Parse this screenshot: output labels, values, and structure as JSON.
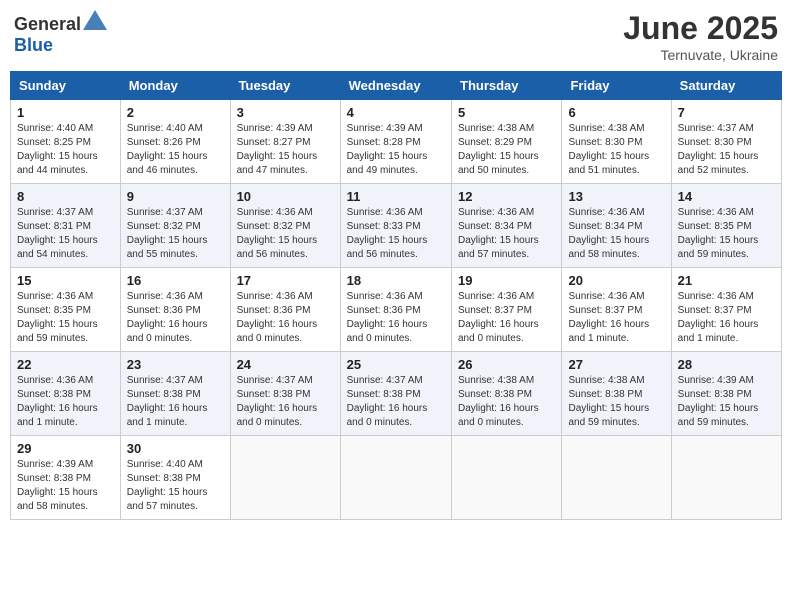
{
  "header": {
    "logo_general": "General",
    "logo_blue": "Blue",
    "month_title": "June 2025",
    "subtitle": "Ternuvate, Ukraine"
  },
  "days_of_week": [
    "Sunday",
    "Monday",
    "Tuesday",
    "Wednesday",
    "Thursday",
    "Friday",
    "Saturday"
  ],
  "weeks": [
    [
      {
        "day": "1",
        "info": "Sunrise: 4:40 AM\nSunset: 8:25 PM\nDaylight: 15 hours\nand 44 minutes."
      },
      {
        "day": "2",
        "info": "Sunrise: 4:40 AM\nSunset: 8:26 PM\nDaylight: 15 hours\nand 46 minutes."
      },
      {
        "day": "3",
        "info": "Sunrise: 4:39 AM\nSunset: 8:27 PM\nDaylight: 15 hours\nand 47 minutes."
      },
      {
        "day": "4",
        "info": "Sunrise: 4:39 AM\nSunset: 8:28 PM\nDaylight: 15 hours\nand 49 minutes."
      },
      {
        "day": "5",
        "info": "Sunrise: 4:38 AM\nSunset: 8:29 PM\nDaylight: 15 hours\nand 50 minutes."
      },
      {
        "day": "6",
        "info": "Sunrise: 4:38 AM\nSunset: 8:30 PM\nDaylight: 15 hours\nand 51 minutes."
      },
      {
        "day": "7",
        "info": "Sunrise: 4:37 AM\nSunset: 8:30 PM\nDaylight: 15 hours\nand 52 minutes."
      }
    ],
    [
      {
        "day": "8",
        "info": "Sunrise: 4:37 AM\nSunset: 8:31 PM\nDaylight: 15 hours\nand 54 minutes."
      },
      {
        "day": "9",
        "info": "Sunrise: 4:37 AM\nSunset: 8:32 PM\nDaylight: 15 hours\nand 55 minutes."
      },
      {
        "day": "10",
        "info": "Sunrise: 4:36 AM\nSunset: 8:32 PM\nDaylight: 15 hours\nand 56 minutes."
      },
      {
        "day": "11",
        "info": "Sunrise: 4:36 AM\nSunset: 8:33 PM\nDaylight: 15 hours\nand 56 minutes."
      },
      {
        "day": "12",
        "info": "Sunrise: 4:36 AM\nSunset: 8:34 PM\nDaylight: 15 hours\nand 57 minutes."
      },
      {
        "day": "13",
        "info": "Sunrise: 4:36 AM\nSunset: 8:34 PM\nDaylight: 15 hours\nand 58 minutes."
      },
      {
        "day": "14",
        "info": "Sunrise: 4:36 AM\nSunset: 8:35 PM\nDaylight: 15 hours\nand 59 minutes."
      }
    ],
    [
      {
        "day": "15",
        "info": "Sunrise: 4:36 AM\nSunset: 8:35 PM\nDaylight: 15 hours\nand 59 minutes."
      },
      {
        "day": "16",
        "info": "Sunrise: 4:36 AM\nSunset: 8:36 PM\nDaylight: 16 hours\nand 0 minutes."
      },
      {
        "day": "17",
        "info": "Sunrise: 4:36 AM\nSunset: 8:36 PM\nDaylight: 16 hours\nand 0 minutes."
      },
      {
        "day": "18",
        "info": "Sunrise: 4:36 AM\nSunset: 8:36 PM\nDaylight: 16 hours\nand 0 minutes."
      },
      {
        "day": "19",
        "info": "Sunrise: 4:36 AM\nSunset: 8:37 PM\nDaylight: 16 hours\nand 0 minutes."
      },
      {
        "day": "20",
        "info": "Sunrise: 4:36 AM\nSunset: 8:37 PM\nDaylight: 16 hours\nand 1 minute."
      },
      {
        "day": "21",
        "info": "Sunrise: 4:36 AM\nSunset: 8:37 PM\nDaylight: 16 hours\nand 1 minute."
      }
    ],
    [
      {
        "day": "22",
        "info": "Sunrise: 4:36 AM\nSunset: 8:38 PM\nDaylight: 16 hours\nand 1 minute."
      },
      {
        "day": "23",
        "info": "Sunrise: 4:37 AM\nSunset: 8:38 PM\nDaylight: 16 hours\nand 1 minute."
      },
      {
        "day": "24",
        "info": "Sunrise: 4:37 AM\nSunset: 8:38 PM\nDaylight: 16 hours\nand 0 minutes."
      },
      {
        "day": "25",
        "info": "Sunrise: 4:37 AM\nSunset: 8:38 PM\nDaylight: 16 hours\nand 0 minutes."
      },
      {
        "day": "26",
        "info": "Sunrise: 4:38 AM\nSunset: 8:38 PM\nDaylight: 16 hours\nand 0 minutes."
      },
      {
        "day": "27",
        "info": "Sunrise: 4:38 AM\nSunset: 8:38 PM\nDaylight: 15 hours\nand 59 minutes."
      },
      {
        "day": "28",
        "info": "Sunrise: 4:39 AM\nSunset: 8:38 PM\nDaylight: 15 hours\nand 59 minutes."
      }
    ],
    [
      {
        "day": "29",
        "info": "Sunrise: 4:39 AM\nSunset: 8:38 PM\nDaylight: 15 hours\nand 58 minutes."
      },
      {
        "day": "30",
        "info": "Sunrise: 4:40 AM\nSunset: 8:38 PM\nDaylight: 15 hours\nand 57 minutes."
      },
      {
        "day": "",
        "info": ""
      },
      {
        "day": "",
        "info": ""
      },
      {
        "day": "",
        "info": ""
      },
      {
        "day": "",
        "info": ""
      },
      {
        "day": "",
        "info": ""
      }
    ]
  ]
}
